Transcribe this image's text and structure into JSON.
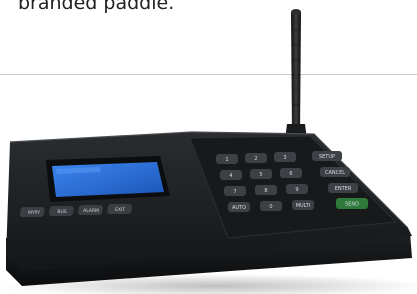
{
  "caption": "branded paddle.",
  "device": {
    "function_keys": [
      "MYPY",
      "BUS",
      "ALARM",
      "EXIT"
    ],
    "keypad_rows": [
      [
        "1",
        "2",
        "3",
        "SETUP"
      ],
      [
        "4",
        "5",
        "6",
        "CANCEL"
      ],
      [
        "7",
        "8",
        "9",
        "ENTER"
      ],
      [
        "AUTO",
        "0",
        "MULTI",
        "SEND"
      ]
    ],
    "colors": {
      "body": "#1a1c1e",
      "lcd": "#2a6fd6",
      "send_key": "#2f7a3a"
    }
  }
}
